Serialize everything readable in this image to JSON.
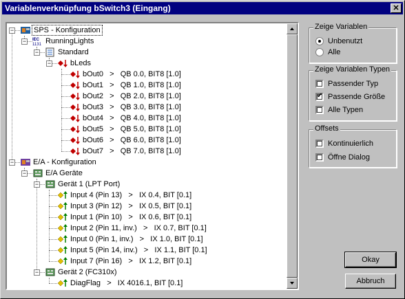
{
  "window": {
    "title": "Variablenverknüpfung bSwitch3 (Eingang)",
    "close_glyph": "✕"
  },
  "tree": [
    {
      "label": "SPS - Konfiguration",
      "icon": "plc-config-icon",
      "depth": 0,
      "expander": "−",
      "selected": true
    },
    {
      "label": "RunningLights",
      "icon": "iec-program-icon",
      "depth": 1,
      "expander": "−"
    },
    {
      "label": "Standard",
      "icon": "task-icon",
      "depth": 2,
      "expander": "−"
    },
    {
      "label": "bLeds",
      "icon": "output-array-icon",
      "depth": 3,
      "expander": "−"
    },
    {
      "label": "bOut0   >   QB 0.0, BIT8 [1.0]",
      "icon": "output-var-icon",
      "depth": 4
    },
    {
      "label": "bOut1   >   QB 1.0, BIT8 [1.0]",
      "icon": "output-var-icon",
      "depth": 4
    },
    {
      "label": "bOut2   >   QB 2.0, BIT8 [1.0]",
      "icon": "output-var-icon",
      "depth": 4
    },
    {
      "label": "bOut3   >   QB 3.0, BIT8 [1.0]",
      "icon": "output-var-icon",
      "depth": 4
    },
    {
      "label": "bOut4   >   QB 4.0, BIT8 [1.0]",
      "icon": "output-var-icon",
      "depth": 4
    },
    {
      "label": "bOut5   >   QB 5.0, BIT8 [1.0]",
      "icon": "output-var-icon",
      "depth": 4
    },
    {
      "label": "bOut6   >   QB 6.0, BIT8 [1.0]",
      "icon": "output-var-icon",
      "depth": 4
    },
    {
      "label": "bOut7   >   QB 7.0, BIT8 [1.0]",
      "icon": "output-var-icon",
      "depth": 4
    },
    {
      "label": "E/A - Konfiguration",
      "icon": "io-config-icon",
      "depth": 0,
      "expander": "−"
    },
    {
      "label": "E/A Geräte",
      "icon": "io-devices-icon",
      "depth": 1,
      "expander": "−"
    },
    {
      "label": "Gerät 1 (LPT Port)",
      "icon": "device-icon",
      "depth": 2,
      "expander": "−"
    },
    {
      "label": "Input 4 (Pin 13)   >   IX 0.4, BIT [0.1]",
      "icon": "input-var-icon",
      "depth": 3
    },
    {
      "label": "Input 3 (Pin 12)   >   IX 0.5, BIT [0.1]",
      "icon": "input-var-icon",
      "depth": 3
    },
    {
      "label": "Input 1 (Pin 10)   >   IX 0.6, BIT [0.1]",
      "icon": "input-var-icon",
      "depth": 3
    },
    {
      "label": "Input 2 (Pin 11, inv.)   >   IX 0.7, BIT [0.1]",
      "icon": "input-var-icon",
      "depth": 3
    },
    {
      "label": "Input 0 (Pin 1, inv.)   >   IX 1.0, BIT [0.1]",
      "icon": "input-var-icon",
      "depth": 3
    },
    {
      "label": "Input 5 (Pin 14, inv.)   >   IX 1.1, BIT [0.1]",
      "icon": "input-var-icon",
      "depth": 3
    },
    {
      "label": "Input 7 (Pin 16)   >   IX 1.2, BIT [0.1]",
      "icon": "input-var-icon",
      "depth": 3
    },
    {
      "label": "Gerät 2 (FC310x)",
      "icon": "device-icon",
      "depth": 2,
      "expander": "−"
    },
    {
      "label": "DiagFlag   >   IX 4016.1, BIT [0.1]",
      "icon": "input-var-icon",
      "depth": 3
    }
  ],
  "groups": {
    "show_vars": {
      "title": "Zeige Variablen",
      "options": [
        {
          "label": "Unbenutzt",
          "type": "radio",
          "checked": true
        },
        {
          "label": "Alle",
          "type": "radio",
          "checked": false
        }
      ]
    },
    "show_types": {
      "title": "Zeige Variablen Typen",
      "options": [
        {
          "label": "Passender Typ",
          "type": "check",
          "checked": false
        },
        {
          "label": "Passende Größe",
          "type": "check",
          "checked": true
        },
        {
          "label": "Alle Typen",
          "type": "check",
          "checked": false
        }
      ]
    },
    "offsets": {
      "title": "Offsets",
      "options": [
        {
          "label": "Kontinuierlich",
          "type": "check",
          "checked": false
        },
        {
          "label": "Öffne Dialog",
          "type": "check",
          "checked": false
        }
      ]
    }
  },
  "buttons": {
    "ok": "Okay",
    "cancel": "Abbruch"
  }
}
